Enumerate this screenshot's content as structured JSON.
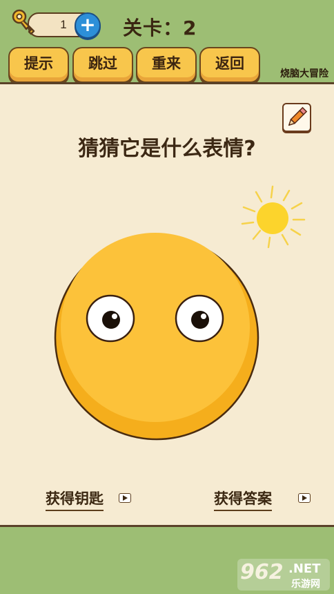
{
  "keys": {
    "count": "1",
    "add_symbol": "+"
  },
  "level": {
    "label": "关卡：2"
  },
  "toolbar": {
    "hint": "提示",
    "skip": "跳过",
    "retry": "重来",
    "back": "返回"
  },
  "game_title": "烧脑大冒险",
  "question": "猜猜它是什么表情?",
  "bottom": {
    "get_key": "获得钥匙",
    "get_answer": "获得答案"
  },
  "watermark": {
    "brand": "962",
    "suffix": ".NET",
    "sub": "乐游网"
  },
  "icons": [
    "key-icon",
    "plus-icon",
    "pencil-icon",
    "sun-icon",
    "play-icon"
  ],
  "colors": {
    "background": "#9dbe74",
    "panel": "#f6ebd2",
    "button": "#f8c64c",
    "face": "#fcc23a"
  }
}
